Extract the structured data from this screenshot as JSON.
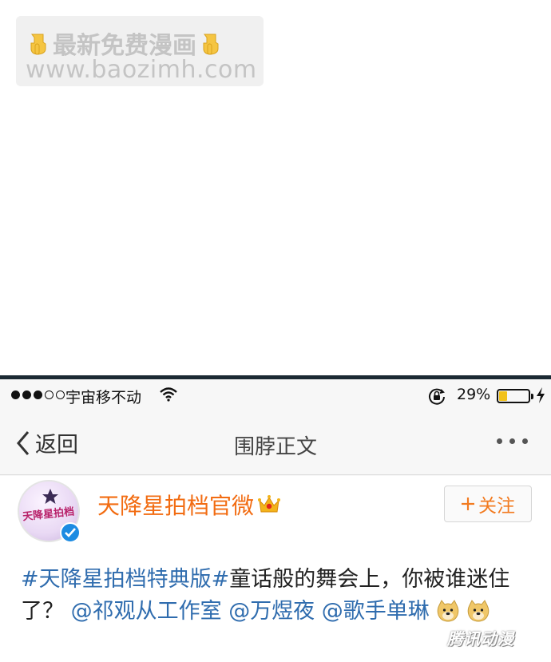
{
  "watermark": {
    "line1": "最新免费漫画",
    "line2": "www.baozimh.com"
  },
  "statusbar": {
    "carrier": "宇宙移不动",
    "battery_percent": "29%",
    "battery_level": 0.29,
    "battery_color": "#f2c21c"
  },
  "navbar": {
    "back_label": "返回",
    "title": "围脖正文"
  },
  "post": {
    "username": "天降星拍档官微",
    "avatar_text": "天降星拍档",
    "follow_label": "关注",
    "hashtag": "#天降星拍档特典版#",
    "text_main": "童话般的舞会上，你被谁迷住了？",
    "mentions": [
      "@祁观从工作室",
      "@万煜夜",
      "@歌手单琳"
    ],
    "username_color": "#f26c12",
    "link_color": "#2f6cae"
  },
  "corner_watermark": "腾讯动漫"
}
